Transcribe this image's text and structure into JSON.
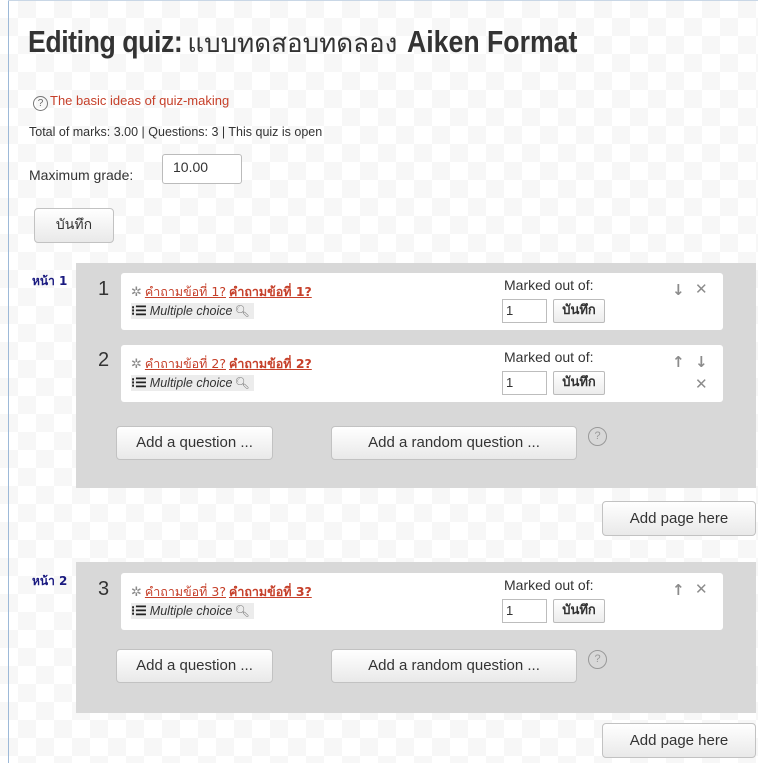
{
  "title": {
    "prefix": "Editing quiz:",
    "thai_name": "แบบทดสอบทดลอง",
    "suffix": "Aiken Format"
  },
  "help_link": "The basic ideas of quiz-making",
  "summary": "Total of marks: 3.00 | Questions: 3 | This quiz is open",
  "max_grade": {
    "label": "Maximum grade:",
    "value": "10.00"
  },
  "save_label": "บันทึก",
  "pages": [
    {
      "label": "หน้า 1",
      "questions": [
        {
          "number": "1",
          "name": "คำถามข้อที่ 1?",
          "text": "คำถามข้อที่ 1?",
          "type": "Multiple choice",
          "marked_label": "Marked out of:",
          "mark": "1",
          "save": "บันทึก",
          "actions": [
            "down-arrow",
            "delete"
          ]
        },
        {
          "number": "2",
          "name": "คำถามข้อที่ 2?",
          "text": "คำถามข้อที่ 2?",
          "type": "Multiple choice",
          "marked_label": "Marked out of:",
          "mark": "1",
          "save": "บันทึก",
          "actions": [
            "up-arrow",
            "down-arrow",
            "delete"
          ]
        }
      ],
      "add_question": "Add a question ...",
      "add_random": "Add a random question ...",
      "add_page": "Add page here"
    },
    {
      "label": "หน้า 2",
      "questions": [
        {
          "number": "3",
          "name": "คำถามข้อที่ 3?",
          "text": "คำถามข้อที่ 3?",
          "type": "Multiple choice",
          "marked_label": "Marked out of:",
          "mark": "1",
          "save": "บันทึก",
          "actions": [
            "up-arrow",
            "delete"
          ]
        }
      ],
      "add_question": "Add a question ...",
      "add_random": "Add a random question ...",
      "add_page": "Add page here"
    }
  ],
  "icons": {
    "help": "question-circle-icon",
    "gear": "gear-icon",
    "type": "multichoice-list-icon",
    "preview": "magnifier-icon",
    "up": "up-arrow-icon",
    "down": "down-arrow-icon",
    "delete": "delete-x-icon"
  },
  "colors": {
    "link": "#c6402a",
    "section_bg": "#d8d8d8",
    "page_label": "#1a1a80"
  }
}
